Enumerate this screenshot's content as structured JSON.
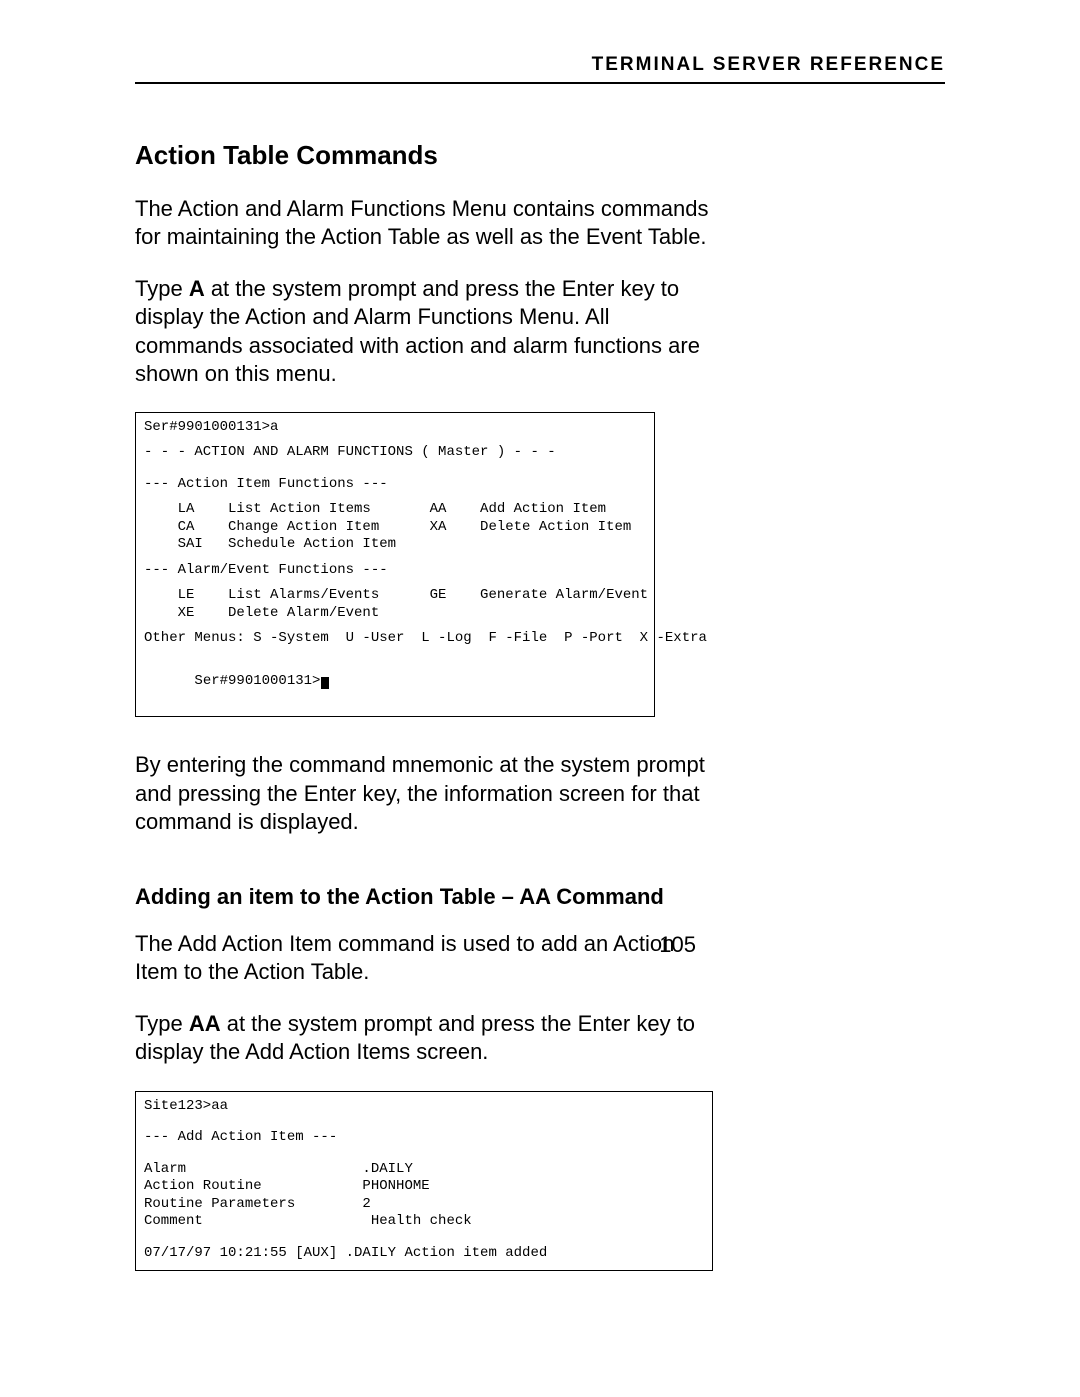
{
  "header": {
    "running_head": "TERMINAL SERVER REFERENCE"
  },
  "section": {
    "title": "Action Table Commands",
    "para1": "The Action and Alarm Functions Menu contains commands for maintaining the Action Table as well as the Event Table.",
    "para2_pre": "Type ",
    "para2_bold": "A",
    "para2_post": " at the system prompt and press the Enter key to display the Action and Alarm Functions Menu.  All commands associated with action and alarm functions are shown on this menu.",
    "after_box": "By entering the command mnemonic at the system prompt and pressing the Enter key, the information screen for that command is displayed."
  },
  "menu_box": {
    "prompt_top": "Ser#9901000131>a",
    "title": "- - - ACTION AND ALARM FUNCTIONS ( Master ) - - -",
    "group1_header": "--- Action Item Functions ---",
    "group1": [
      {
        "l_code": "LA",
        "l_desc": "List Action Items",
        "r_code": "AA",
        "r_desc": "Add Action Item"
      },
      {
        "l_code": "CA",
        "l_desc": "Change Action Item",
        "r_code": "XA",
        "r_desc": "Delete Action Item"
      },
      {
        "l_code": "SAI",
        "l_desc": "Schedule Action Item",
        "r_code": "",
        "r_desc": ""
      }
    ],
    "group2_header": "--- Alarm/Event Functions ---",
    "group2": [
      {
        "l_code": "LE",
        "l_desc": "List Alarms/Events",
        "r_code": "GE",
        "r_desc": "Generate Alarm/Event"
      },
      {
        "l_code": "XE",
        "l_desc": "Delete Alarm/Event",
        "r_code": "",
        "r_desc": ""
      }
    ],
    "other_menus": "Other Menus: S -System  U -User  L -Log  F -File  P -Port  X -Extra",
    "prompt_bottom": "Ser#9901000131>"
  },
  "subsection": {
    "title": "Adding an item to the Action Table – AA Command",
    "para1": "The Add Action Item command is used to add an Action Item to the Action Table.",
    "para2_pre": "Type ",
    "para2_bold": "AA",
    "para2_post": "  at the system prompt and press the Enter key to display the Add Action Items screen."
  },
  "aa_box": {
    "prompt": "Site123>aa",
    "header": "--- Add Action Item ---",
    "fields": [
      {
        "label": "Alarm",
        "value": ".DAILY"
      },
      {
        "label": "Action Routine",
        "value": "PHONHOME"
      },
      {
        "label": "Routine Parameters",
        "value": "2"
      },
      {
        "label": "Comment",
        "value": " Health check"
      }
    ],
    "status": "07/17/97 10:21:55 [AUX] .DAILY Action item added"
  },
  "page_number": "105"
}
